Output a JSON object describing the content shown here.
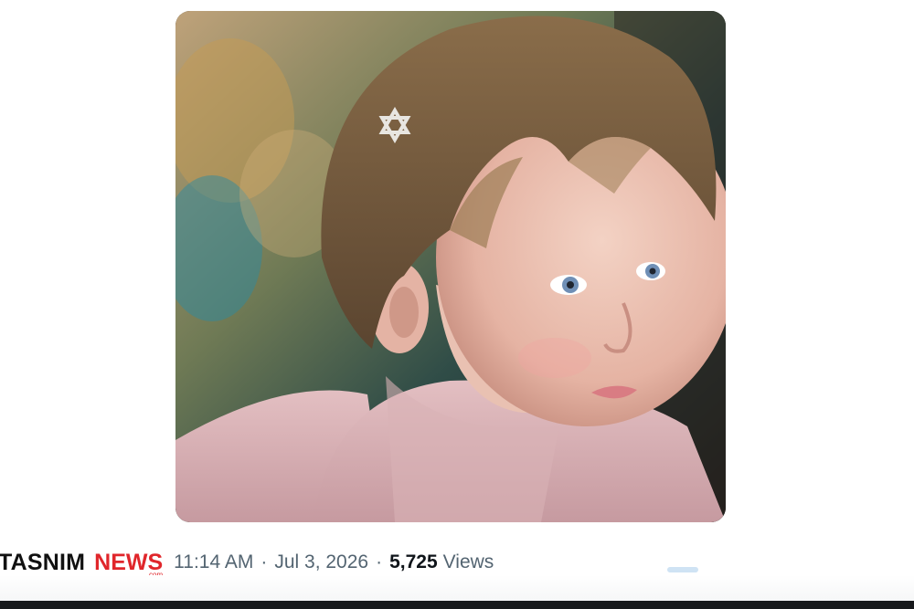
{
  "post": {
    "media": {
      "alt_icon": "photo-icon",
      "type": "photo"
    },
    "meta": {
      "time": "11:14 AM",
      "separator": "·",
      "date": "Jul 3, 2026",
      "views_count": "5,725",
      "views_label": "Views"
    }
  },
  "watermark": {
    "left": "TASNIM",
    "right": "NEWS",
    "suffix": ".com"
  },
  "colors": {
    "brand_red": "#e0262b",
    "meta_gray": "#536471",
    "text_dark": "#0f1419"
  }
}
